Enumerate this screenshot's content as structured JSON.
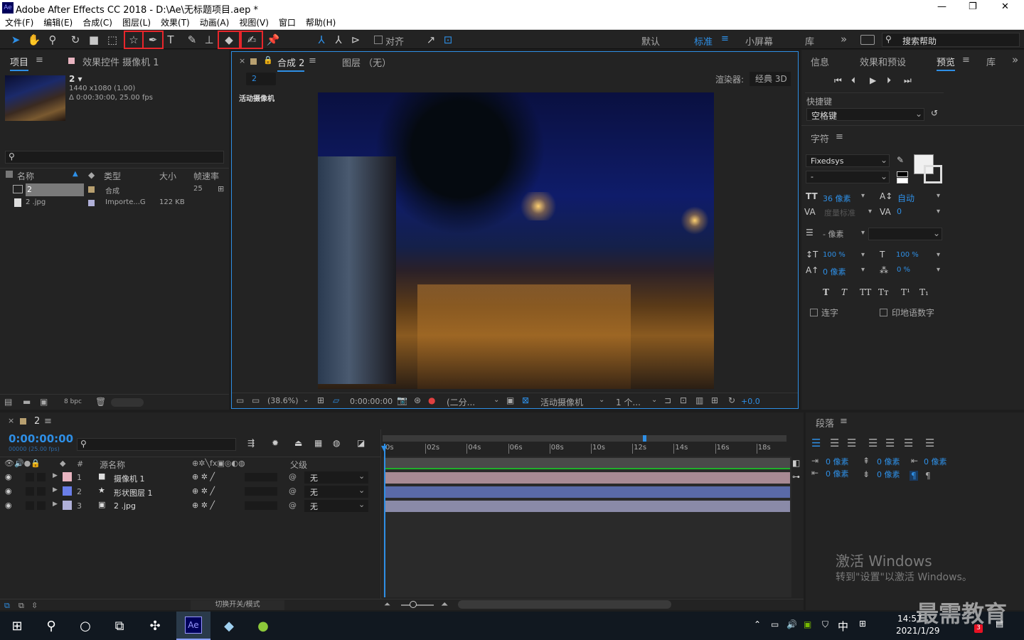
{
  "window": {
    "title": "Adobe After Effects CC 2018 - D:\\Ae\\无标题项目.aep *",
    "app_icon": "Ae",
    "min": "—",
    "max": "❐",
    "close": "✕"
  },
  "menu": [
    "文件(F)",
    "编辑(E)",
    "合成(C)",
    "图层(L)",
    "效果(T)",
    "动画(A)",
    "视图(V)",
    "窗口",
    "帮助(H)"
  ],
  "toolbar": {
    "snap_label": "对齐",
    "workspaces": [
      "默认",
      "标准",
      "小屏幕",
      "库"
    ],
    "active_workspace": "标准",
    "more": "»",
    "search_placeholder": "搜索帮助"
  },
  "project": {
    "tab": "项目",
    "effects_tab": "效果控件 摄像机 1",
    "comp_name": "2 ▾",
    "comp_info1": "1440 x1080 (1.00)",
    "comp_info2": "Δ 0:00:30:00, 25.00 fps",
    "columns": {
      "name": "名称",
      "type": "类型",
      "size": "大小",
      "fps": "帧速率"
    },
    "items": [
      {
        "name": "2",
        "type": "合成",
        "size": "",
        "fps": "25"
      },
      {
        "name": "2 .jpg",
        "type": "Importe...G",
        "size": "122 KB",
        "fps": ""
      }
    ],
    "bpc": "8 bpc"
  },
  "viewer": {
    "tab": "合成 2",
    "layer_tab": "图层 （无）",
    "comp_chip": "2",
    "renderer_label": "渲染器:",
    "renderer": "经典 3D",
    "camera_label": "活动摄像机",
    "zoom": "(38.6%)",
    "timecode": "0:00:00:00",
    "resolution": "(二分...",
    "view": "活动摄像机",
    "views_count": "1 个...",
    "exposure": "+0.0"
  },
  "right": {
    "tabs": [
      "信息",
      "效果和预设",
      "预览",
      "库"
    ],
    "active_tab": "预览",
    "shortcut_label": "快捷键",
    "shortcut_value": "空格键",
    "char_title": "字符",
    "font": "Fixedsys",
    "style": "-",
    "size": "36 像素",
    "leading": "自动",
    "kerning": "度量标准",
    "tracking": "0",
    "stroke": "- 像素",
    "vscale": "100 %",
    "hscale": "100 %",
    "baseline": "0 像素",
    "tsume": "0 %",
    "ligature": "连字",
    "hindi": "印地语数字",
    "para_title": "段落",
    "indent_l": "0 像素",
    "indent_r": "0 像素",
    "indent_f": "0 像素",
    "space_b": "0 像素",
    "space_a": "0 像素",
    "watermark1": "激活 Windows",
    "watermark2": "转到\"设置\"以激活 Windows。"
  },
  "timeline": {
    "tab": "2",
    "timecode": "0:00:00:00",
    "fps_info": "00000 (25.00 fps)",
    "cols": {
      "hash": "#",
      "source": "源名称",
      "parent": "父级"
    },
    "ticks": [
      "0s",
      "02s",
      "04s",
      "06s",
      "08s",
      "10s",
      "12s",
      "14s",
      "16s",
      "18s"
    ],
    "layers": [
      {
        "num": "1",
        "name": "摄像机 1",
        "icon": "camera-icon",
        "color": "#e8b4c0",
        "parent": "无",
        "bar": "#a88a94"
      },
      {
        "num": "2",
        "name": "形状图层 1",
        "icon": "star-icon",
        "color": "#6a7ee8",
        "parent": "无",
        "bar": "#5a6aa8"
      },
      {
        "num": "3",
        "name": "2 .jpg",
        "icon": "image-icon",
        "color": "#b0b0d8",
        "parent": "无",
        "bar": "#8a8aa8"
      }
    ],
    "mode_toggle": "切换开关/模式"
  },
  "taskbar": {
    "time": "14:57",
    "date": "2021/1/29",
    "lang": "中",
    "notif": "3",
    "brand": "最需教育"
  },
  "colors": {
    "accent": "#2e8fe6",
    "highlight": "#e8262b"
  }
}
